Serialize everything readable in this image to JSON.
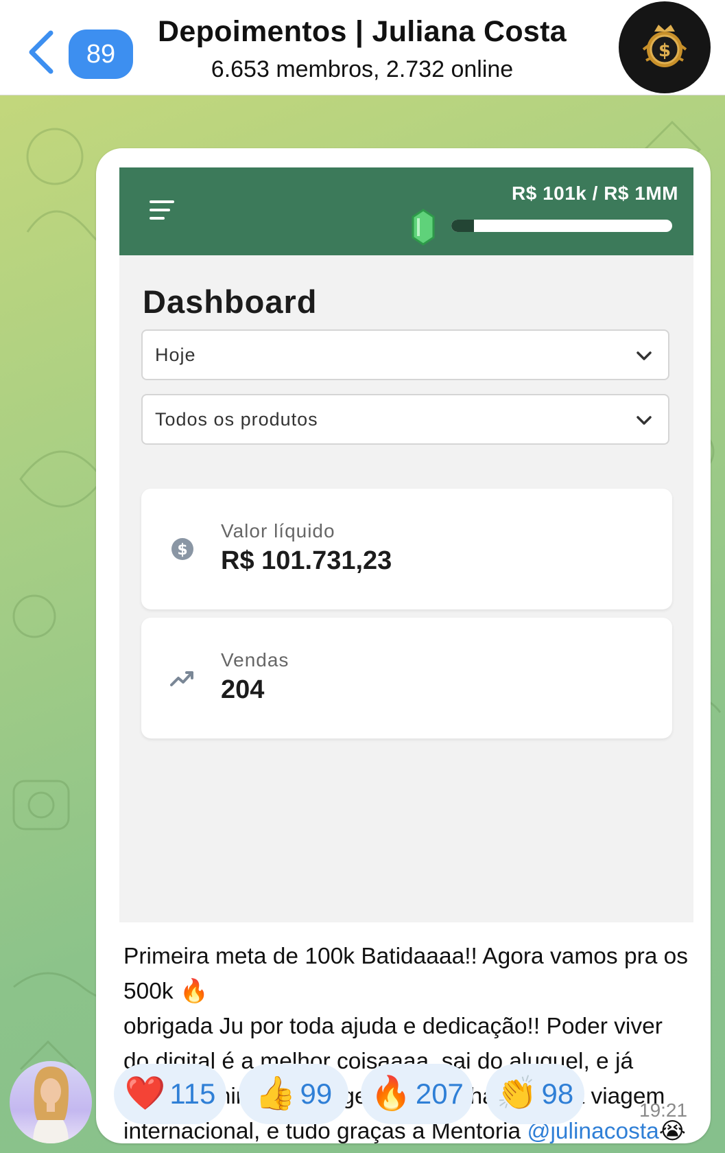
{
  "header": {
    "back_icon": "chevron-left-icon",
    "unread_count": "89",
    "title": "Depoimentos | Juliana Costa",
    "subtitle": "6.653 membros, 2.732 online",
    "avatar_icon": "dollar-crown-icon"
  },
  "screenshot": {
    "goal_text": "R$ 101k / R$ 1MM",
    "progress_fraction": 0.101,
    "dashboard_title": "Dashboard",
    "period_select": "Hoje",
    "product_select": "Todos os produtos",
    "cards": [
      {
        "label": "Valor líquido",
        "value": "R$ 101.731,23",
        "icon": "dollar-circle-icon"
      },
      {
        "label": "Vendas",
        "value": "204",
        "icon": "trending-up-icon"
      }
    ]
  },
  "message": {
    "line1": "Primeira meta de 100k Batidaaaa!! Agora vamos pra os 500k 🔥",
    "line2": "obrigada Ju por toda ajuda e dedicação!! Poder viver do digital é a melhor coisaaaa, sai do aluguel, e já comprei minha passagem pra minha primeira viagem internacional, e tudo graças a Mentoria ",
    "mention": "@julinacosta",
    "trailing_emoji": "😭🙏🏻",
    "time": "19:21"
  },
  "reactions": [
    {
      "emoji": "❤️",
      "count": "115"
    },
    {
      "emoji": "👍",
      "count": "99"
    },
    {
      "emoji": "🔥",
      "count": "207"
    },
    {
      "emoji": "👏",
      "count": "98"
    }
  ],
  "colors": {
    "accent": "#3d8ff0",
    "dashboard_green": "#3c7a5a",
    "reaction_bg": "#e6f0fb",
    "reaction_text": "#2f7fd6"
  }
}
